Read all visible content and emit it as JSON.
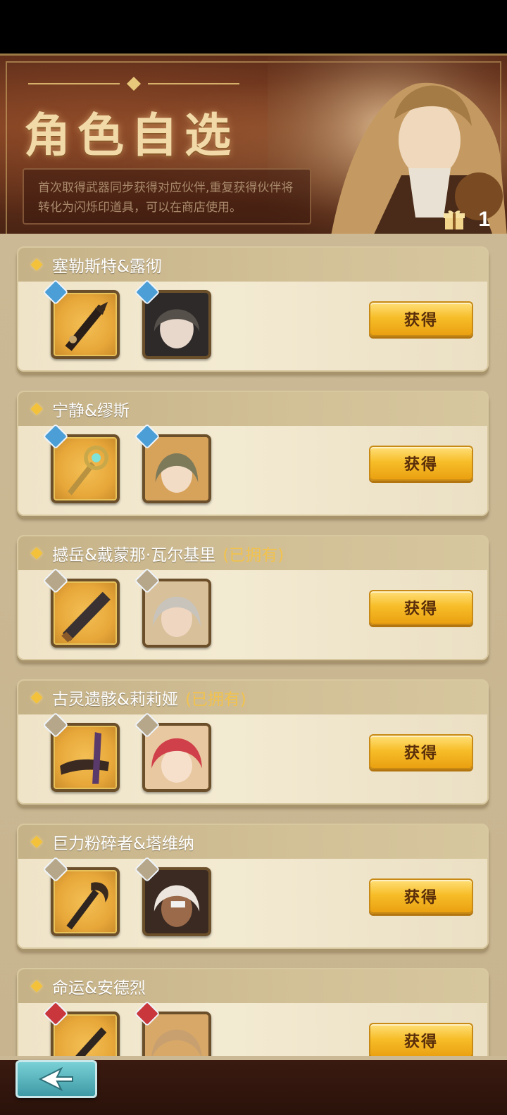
{
  "banner": {
    "title": "角色自选",
    "description": "首次取得武器同步获得对应伙伴,重复获得伙伴将转化为闪烁印道具，可以在商店使用。",
    "gift_count": "1"
  },
  "labels": {
    "get": "获得",
    "owned": "(已拥有)"
  },
  "items": [
    {
      "name": "塞勒斯特&露彻",
      "owned": false,
      "element": "water"
    },
    {
      "name": "宁静&缪斯",
      "owned": false,
      "element": "water"
    },
    {
      "name": "撼岳&戴蒙那·瓦尔基里",
      "owned": true,
      "element": "neutral"
    },
    {
      "name": "古灵遗骸&莉莉娅",
      "owned": true,
      "element": "neutral"
    },
    {
      "name": "巨力粉碎者&塔维纳",
      "owned": false,
      "element": "neutral"
    },
    {
      "name": "命运&安德烈",
      "owned": false,
      "element": "fire"
    }
  ],
  "colors": {
    "accent": "#f3c23a",
    "owned_text": "#f1c24d",
    "button": "#f7be2a",
    "back_button": "#3e9aa6"
  }
}
